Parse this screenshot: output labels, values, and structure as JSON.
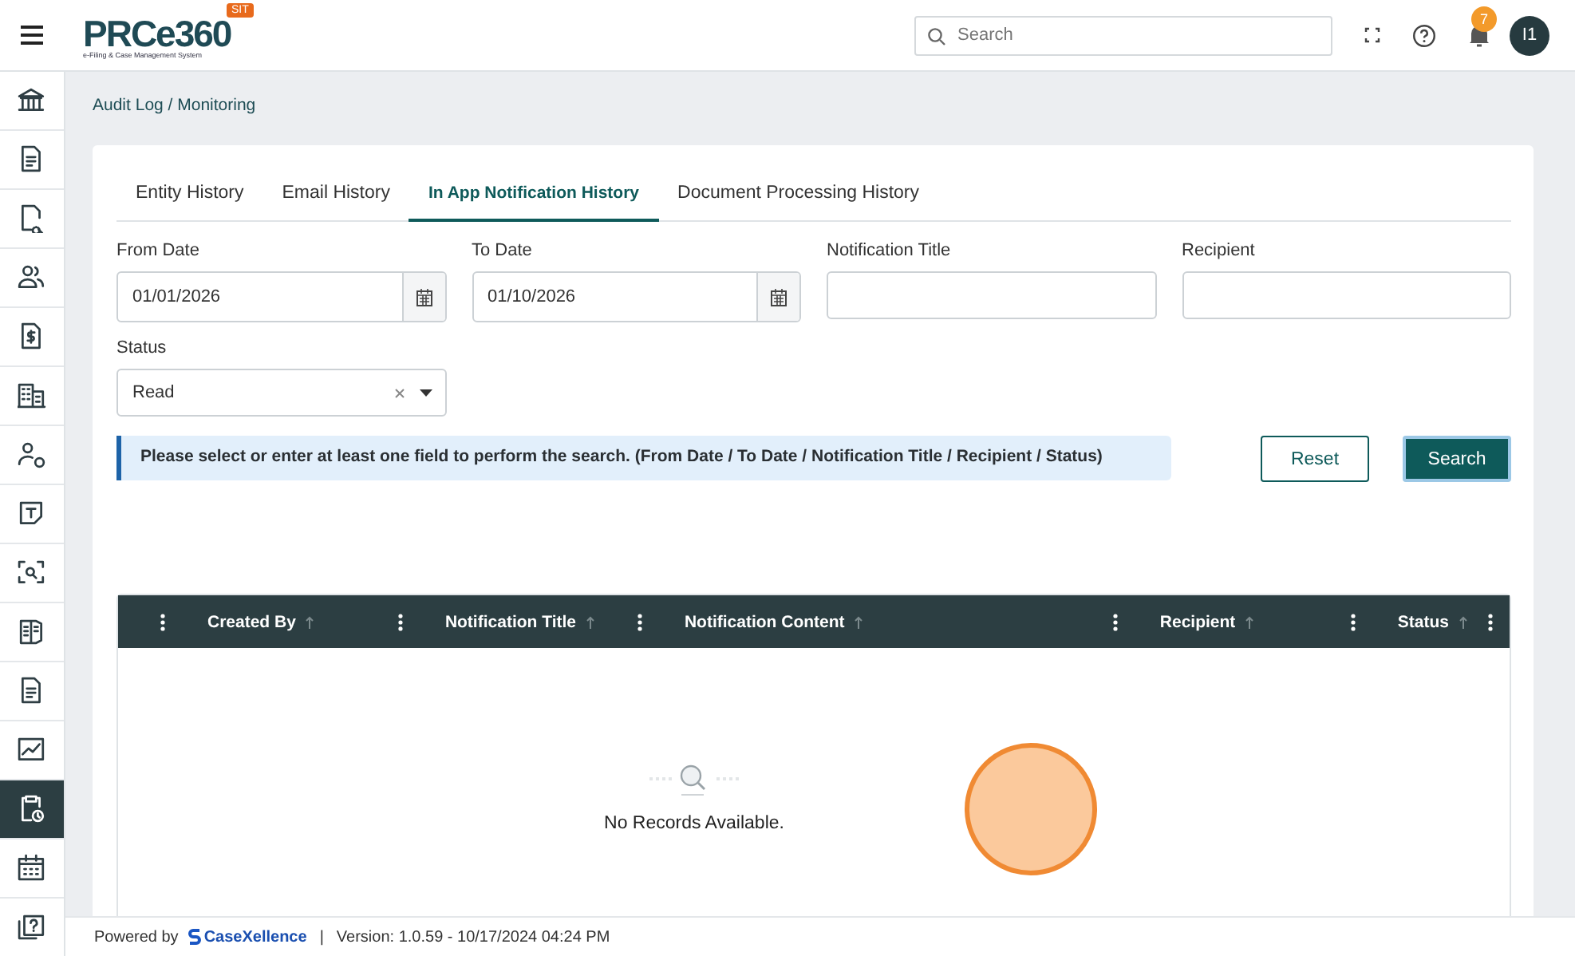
{
  "header": {
    "logo": "PRCe360",
    "logo_tagline": "e-Filing & Case Management System",
    "env_badge": "SIT",
    "search": {
      "placeholder": "Search"
    },
    "notification_count": "7",
    "avatar": "I1"
  },
  "sidebar": {
    "items": [
      {
        "selected": false
      },
      {
        "selected": false
      },
      {
        "selected": false
      },
      {
        "selected": false
      },
      {
        "selected": false
      },
      {
        "selected": false
      },
      {
        "selected": false
      },
      {
        "selected": false
      },
      {
        "selected": false
      },
      {
        "selected": false
      },
      {
        "selected": false
      },
      {
        "selected": false
      },
      {
        "selected": true
      },
      {
        "selected": false
      },
      {
        "selected": false
      }
    ]
  },
  "breadcrumb": "Audit Log / Monitoring",
  "tabs": [
    {
      "label": "Entity History",
      "selected": false
    },
    {
      "label": "Email History",
      "selected": false
    },
    {
      "label": "In App Notification History",
      "selected": true
    },
    {
      "label": "Document Processing History",
      "selected": false
    }
  ],
  "filters": [
    {
      "label": "From Date",
      "value": "01/01/2026",
      "kind": "date"
    },
    {
      "label": "To Date",
      "value": "01/10/2026",
      "kind": "date"
    },
    {
      "label": "Notification Title",
      "kind": "text"
    },
    {
      "label": "Recipient",
      "kind": "text"
    },
    {
      "label": "Status",
      "value": "Read",
      "kind": "select"
    }
  ],
  "info_message": "Please select or enter at least one field to perform the search. (From Date / To Date / Notification Title / Recipient / Status)",
  "buttons": [
    {
      "label": "Reset",
      "kind": "secondary"
    },
    {
      "label": "Search",
      "kind": "primary"
    }
  ],
  "table": {
    "columns": [
      "Created By",
      "Notification Title",
      "Notification Content",
      "Recipient",
      "Status"
    ],
    "empty_message": "No Records Available."
  },
  "footer": {
    "powered_by": "Powered by",
    "brand": "CaseXellence",
    "separator": "|",
    "version": "Version: 1.0.59 - 10/17/2024 04:24 PM"
  }
}
